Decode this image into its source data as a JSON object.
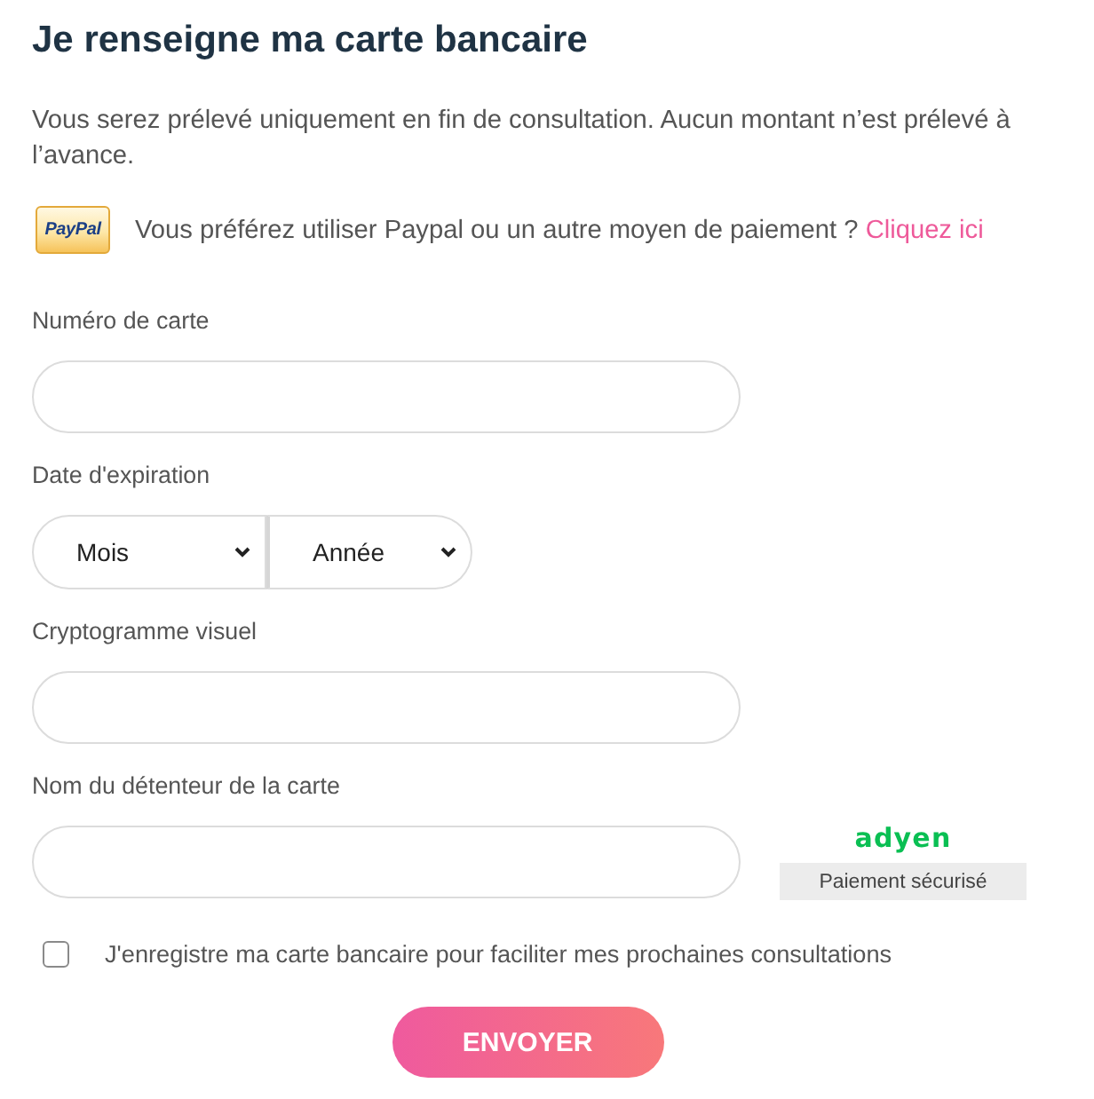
{
  "title": "Je renseigne ma carte bancaire",
  "notice": "Vous serez prélevé uniquement en fin de consultation. Aucun montant n’est prélevé à l’avance.",
  "paypal": {
    "badge": "PayPal",
    "text": "Vous préférez utiliser Paypal ou un autre moyen de paiement ?",
    "link": "Cliquez ici"
  },
  "fields": [
    {
      "kind": "text",
      "label": "Numéro de carte"
    },
    {
      "kind": "selects",
      "label": "Date d'expiration",
      "selects": [
        {
          "value": "Mois"
        },
        {
          "value": "Année"
        }
      ]
    },
    {
      "kind": "text",
      "label": "Cryptogramme visuel"
    },
    {
      "kind": "text",
      "label": "Nom du détenteur de la carte",
      "secure_badge": {
        "logo": "adyen",
        "caption": "Paiement sécurisé"
      }
    }
  ],
  "save_card": {
    "label": "J'enregistre ma carte bancaire pour faciliter mes prochaines consultations",
    "checked": false
  },
  "submit": "ENVOYER"
}
